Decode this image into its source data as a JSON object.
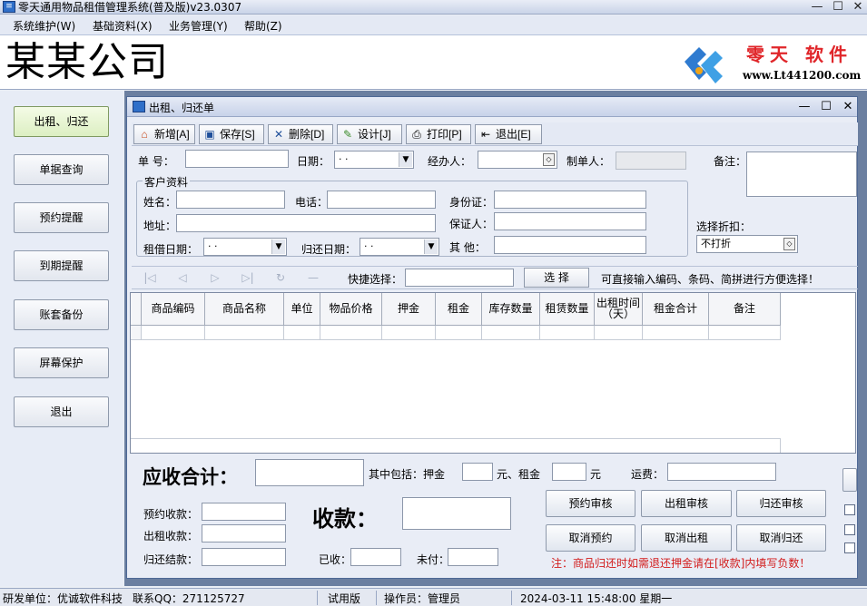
{
  "app": {
    "title": "零天通用物品租借管理系统(普及版)v23.0307",
    "ico": "app-icon"
  },
  "menu": [
    "系统维护(W)",
    "基础资料(X)",
    "业务管理(Y)",
    "帮助(Z)"
  ],
  "banner": {
    "company": "某某公司",
    "logo_name": "零天 软件",
    "logo_url": "www.Lt441200.com"
  },
  "sidebar": [
    "出租、归还",
    "单据查询",
    "预约提醒",
    "到期提醒",
    "账套备份",
    "屏幕保护",
    "退出"
  ],
  "form": {
    "title": "出租、归还单",
    "toolbar": [
      "新增[A]",
      "保存[S]",
      "删除[D]",
      "设计[J]",
      "打印[P]",
      "退出[E]"
    ],
    "doc_no": "单 号：",
    "date": "日期：",
    "date_val": " · · ",
    "handler": "经办人：",
    "maker": "制单人：",
    "remark": "备注：",
    "customer_group": "客户资料",
    "name": "姓名：",
    "phone": "电话：",
    "idcard": "身份证：",
    "address": "地址：",
    "guarantor": "保证人：",
    "rent_date": "租借日期：",
    "rent_date_val": " · · ",
    "return_date": "归还日期：",
    "return_date_val": " · · ",
    "other": "其  他：",
    "discount_label": "选择折扣：",
    "discount_val": "不打折",
    "quick_select": "快捷选择：",
    "select_btn": "选 择",
    "quick_hint": "可直接输入编码、条码、简拼进行方便选择！",
    "nav_icons": [
      "|◁",
      "◁",
      "▷",
      "▷|",
      "↻",
      "—"
    ],
    "columns": [
      "商品编码",
      "商品名称",
      "单位",
      "物品价格",
      "押金",
      "租金",
      "库存数量",
      "租赁数量",
      "出租时间（天）",
      "租金合计",
      "备注"
    ]
  },
  "summary": {
    "total_label": "应收合计：",
    "includes": "其中包括：押金",
    "yuan_rent": "元、租金",
    "yuan": "元",
    "freight": "运费：",
    "reserve_recv": "预约收款：",
    "rent_recv": "出租收款：",
    "return_settle": "归还结款：",
    "collect": "收款：",
    "received": "已收：",
    "unpaid": "未付：",
    "buttons": [
      "预约审核",
      "出租审核",
      "归还审核",
      "取消预约",
      "取消出租",
      "取消归还"
    ],
    "note": "注：商品归还时如需退还押金请在[收款]内填写负数！"
  },
  "status": {
    "dev": "研发单位：优诚软件科技",
    "qq": "联系QQ：271125727",
    "edition": "试用版",
    "operator": "操作员：管理员",
    "datetime": "2024-03-11 15:48:00 星期一"
  },
  "colors": {
    "accent": "#2f6fc9",
    "note_red": "#d21b1b",
    "logo_red": "#e0262a"
  }
}
